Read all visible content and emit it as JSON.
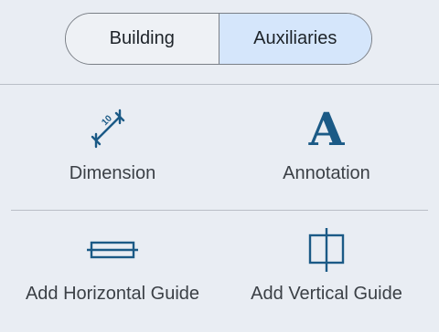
{
  "tabs": [
    {
      "label": "Building",
      "selected": false
    },
    {
      "label": "Auxiliaries",
      "selected": true
    }
  ],
  "tools": {
    "dimension": {
      "label": "Dimension",
      "icon": "dimension-icon",
      "icon_text": "10"
    },
    "annotation": {
      "label": "Annotation",
      "icon": "annotation-icon",
      "glyph": "A"
    },
    "horizontal_guide": {
      "label": "Add Horizontal Guide",
      "icon": "horizontal-guide-icon"
    },
    "vertical_guide": {
      "label": "Add Vertical Guide",
      "icon": "vertical-guide-icon"
    }
  },
  "colors": {
    "background": "#e9edf3",
    "selected_tab": "#d5e6fb",
    "icon": "#1b5a86"
  }
}
